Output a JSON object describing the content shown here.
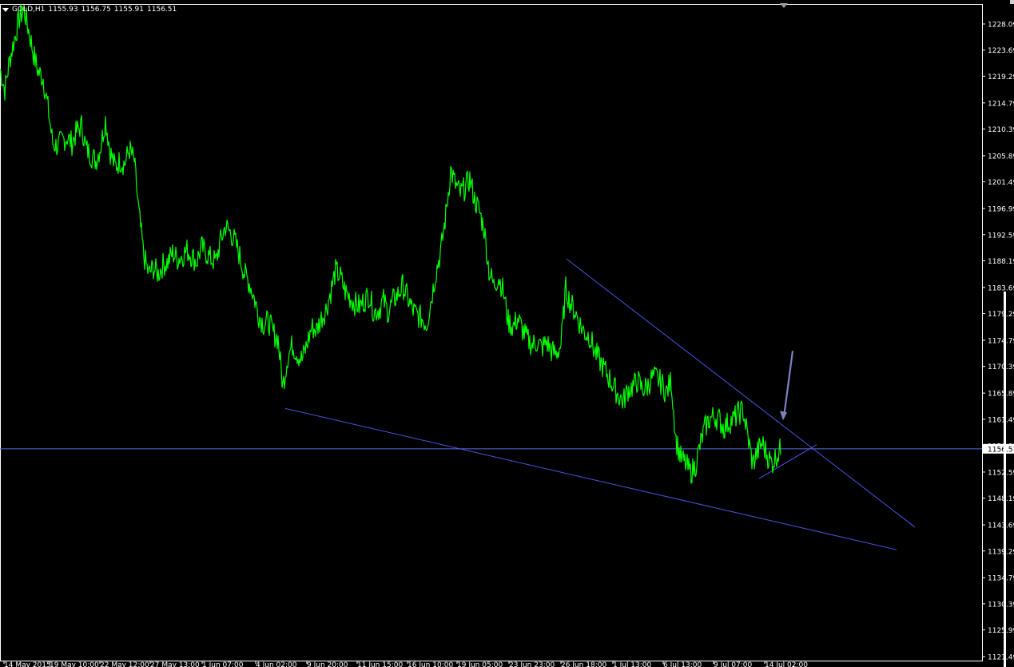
{
  "header": {
    "symbol": "GOLD,H1",
    "open": "1155.93",
    "high": "1156.75",
    "low": "1155.91",
    "close": "1156.51"
  },
  "colors": {
    "background": "#000000",
    "price_line": "#00ff00",
    "trendline": "#4a55dd",
    "horizontal_line": "#5a6ee0",
    "arrow": "#8080c0",
    "axis": "#ffffff",
    "current_price_label_bg": "#ffffff",
    "current_price_label_text": "#000000"
  },
  "chart_data": {
    "type": "line",
    "title": "",
    "price_axis": {
      "ticks": [
        "1228.09",
        "1223.69",
        "1219.29",
        "1214.79",
        "1210.39",
        "1205.89",
        "1201.49",
        "1196.99",
        "1192.59",
        "1188.19",
        "1183.69",
        "1179.29",
        "1174.79",
        "1170.39",
        "1165.89",
        "1161.49",
        "1156.99",
        "1152.59",
        "1148.19",
        "1143.69",
        "1139.29",
        "1134.79",
        "1130.39",
        "1125.99",
        "1121.49"
      ],
      "range": [
        1119.5,
        1231.5
      ],
      "current_price_label": "1156.51"
    },
    "time_axis": {
      "ticks": [
        "14 May 2015",
        "19 May 10:00",
        "22 May 12:00",
        "27 May 13:00",
        "1 Jun 07:00",
        "4 Jun 02:00",
        "9 Jun 20:00",
        "11 Jun 15:00",
        "16 Jun 10:00",
        "19 Jun 05:00",
        "23 Jun 23:00",
        "26 Jun 18:00",
        "1 Jul 13:00",
        "6 Jul 13:00",
        "9 Jul 07:00",
        "14 Jul 02:00"
      ]
    },
    "series": [
      {
        "x_bars": [
          0,
          6,
          12,
          18,
          24,
          30,
          36,
          42,
          48,
          54,
          60,
          66,
          72,
          78,
          84,
          90,
          96,
          102,
          108,
          114,
          120,
          126,
          132,
          138,
          144,
          150,
          156,
          162,
          168,
          174,
          180,
          186,
          192,
          198,
          204,
          210,
          216,
          222,
          228,
          234,
          240,
          246,
          252,
          258,
          264,
          270,
          276,
          282,
          288,
          294,
          300,
          306,
          312,
          318,
          324,
          330,
          336,
          342,
          348,
          354,
          360,
          366,
          372,
          378,
          384,
          390,
          396,
          402,
          408,
          414,
          420,
          426,
          432,
          438,
          444,
          450,
          456,
          462,
          468,
          474,
          480,
          486,
          492,
          498,
          504,
          510,
          516,
          522,
          528,
          534,
          540,
          546,
          552,
          558,
          564,
          570,
          576,
          582,
          588,
          594,
          600,
          606,
          612,
          618,
          624,
          630,
          636,
          642,
          648,
          654,
          660,
          666,
          672,
          678,
          684,
          690,
          696,
          702,
          708,
          714,
          720,
          726,
          732,
          738,
          744,
          750,
          756,
          762,
          768,
          774,
          780,
          786,
          792,
          798,
          804,
          810,
          816,
          822,
          828,
          834,
          840,
          846,
          852,
          858,
          864,
          870,
          876,
          882,
          888,
          894,
          900,
          906,
          912,
          918,
          924,
          930,
          936,
          942,
          948,
          954,
          960,
          966,
          972,
          978,
          984
        ],
        "values": [
          1220.5,
          1217.0,
          1222.0,
          1225.5,
          1229.0,
          1230.5,
          1227.0,
          1223.0,
          1220.0,
          1219.0,
          1214.0,
          1208.0,
          1207.5,
          1208.5,
          1209.0,
          1208.0,
          1210.0,
          1211.0,
          1207.0,
          1206.0,
          1205.0,
          1207.5,
          1212.0,
          1206.5,
          1204.0,
          1205.0,
          1204.5,
          1207.0,
          1205.0,
          1196.0,
          1189.0,
          1186.0,
          1187.0,
          1186.0,
          1187.5,
          1188.0,
          1189.5,
          1188.5,
          1189.0,
          1190.0,
          1189.0,
          1188.0,
          1190.5,
          1189.5,
          1188.5,
          1188.0,
          1191.5,
          1194.0,
          1193.0,
          1191.5,
          1189.0,
          1186.0,
          1184.5,
          1182.0,
          1179.0,
          1177.5,
          1178.0,
          1176.0,
          1175.0,
          1167.0,
          1172.0,
          1174.0,
          1172.5,
          1171.5,
          1174.0,
          1177.0,
          1176.5,
          1178.5,
          1180.0,
          1183.0,
          1186.5,
          1185.5,
          1183.0,
          1182.0,
          1181.0,
          1180.5,
          1181.5,
          1182.5,
          1179.5,
          1180.0,
          1181.5,
          1179.5,
          1181.5,
          1182.5,
          1184.0,
          1182.0,
          1180.0,
          1179.0,
          1178.5,
          1177.5,
          1182.0,
          1186.5,
          1190.0,
          1196.0,
          1203.5,
          1201.0,
          1199.5,
          1200.5,
          1202.0,
          1198.5,
          1196.5,
          1193.5,
          1186.5,
          1184.0,
          1185.5,
          1183.0,
          1178.0,
          1177.0,
          1178.5,
          1176.5,
          1175.0,
          1174.0,
          1174.5,
          1173.5,
          1174.5,
          1173.0,
          1172.5,
          1174.0,
          1183.5,
          1181.0,
          1179.5,
          1177.5,
          1176.0,
          1175.5,
          1173.0,
          1171.5,
          1170.0,
          1168.5,
          1167.0,
          1165.5,
          1164.5,
          1166.5,
          1167.0,
          1168.0,
          1166.5,
          1167.0,
          1168.5,
          1168.5,
          1167.5,
          1166.0,
          1168.0,
          1158.0,
          1155.0,
          1154.0,
          1152.5,
          1153.5,
          1157.0,
          1160.0,
          1161.5,
          1162.0,
          1161.5,
          1160.0,
          1161.0,
          1161.5,
          1162.5,
          1163.0,
          1158.5,
          1154.0,
          1156.0,
          1157.5,
          1155.5,
          1154.0,
          1155.5,
          1156.51
        ]
      }
    ],
    "objects": {
      "trendline_upper": {
        "from": {
          "bar": 709,
          "price": 1188.5
        },
        "to": {
          "bar": 1145,
          "price": 1143.3
        }
      },
      "trendline_lower": {
        "from": {
          "bar": 357,
          "price": 1163.3
        },
        "to": {
          "bar": 1122,
          "price": 1139.5
        }
      },
      "trendline_small": {
        "from": {
          "bar": 950,
          "price": 1151.5
        },
        "to": {
          "bar": 1022,
          "price": 1157.2
        }
      },
      "horizontal_line_price": 1156.51,
      "arrow": {
        "from": {
          "bar": 992,
          "price": 1173.0
        },
        "to": {
          "bar": 980,
          "price": 1161.3
        }
      }
    },
    "grid": false,
    "legend": "none"
  }
}
